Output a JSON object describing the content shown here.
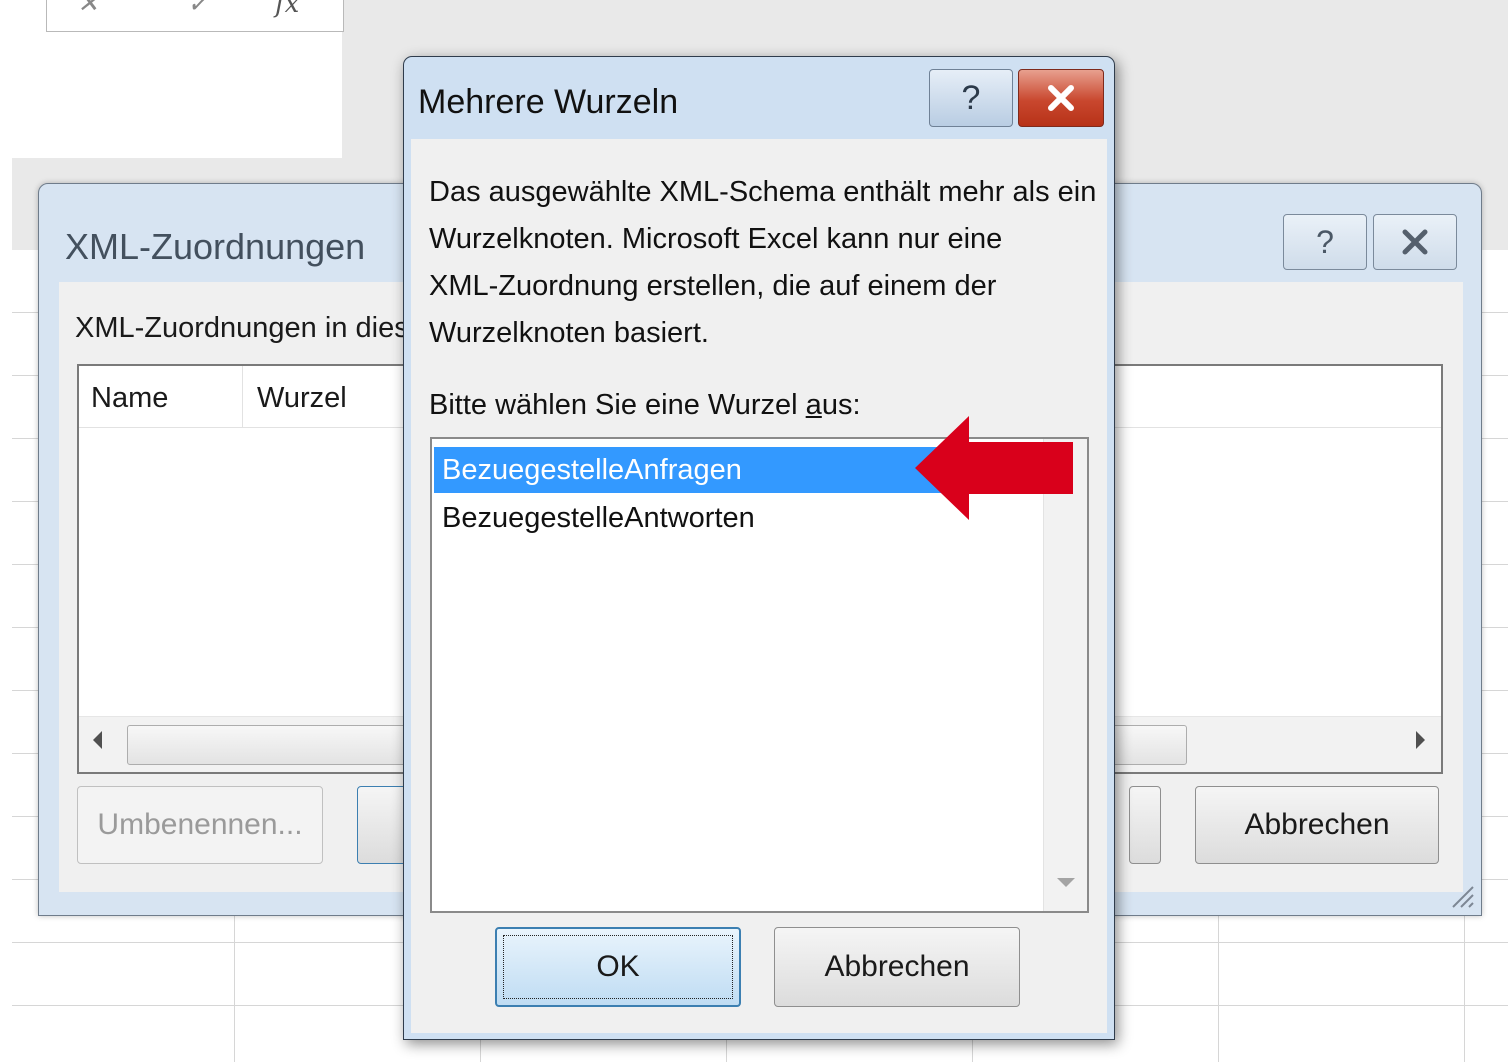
{
  "excel": {
    "namebox_fx": "fx"
  },
  "back_dialog": {
    "title": "XML-Zuordnungen",
    "help_button": "?",
    "caption": "XML-Zuordnungen in dies",
    "columns": [
      "Name",
      "Wurzel"
    ],
    "buttons": {
      "rename": "Umbenennen...",
      "cancel": "Abbrechen"
    }
  },
  "front_dialog": {
    "title": "Mehrere Wurzeln",
    "help_button": "?",
    "message_lines": [
      "Das ausgewählte XML-Schema enthält mehr als ein",
      "Wurzelknoten. Microsoft Excel kann nur eine",
      "XML-Zuordnung erstellen, die auf einem der",
      "Wurzelknoten basiert."
    ],
    "prompt_before": "Bitte wählen Sie eine Wurzel ",
    "prompt_accel": "a",
    "prompt_after": "us:",
    "roots": [
      {
        "label": "BezuegestelleAnfragen",
        "selected": true
      },
      {
        "label": "BezuegestelleAntworten",
        "selected": false
      }
    ],
    "buttons": {
      "ok": "OK",
      "cancel": "Abbrechen"
    }
  },
  "annotation": {
    "arrow_color": "#d9001b",
    "selection_color": "#3399ff"
  }
}
